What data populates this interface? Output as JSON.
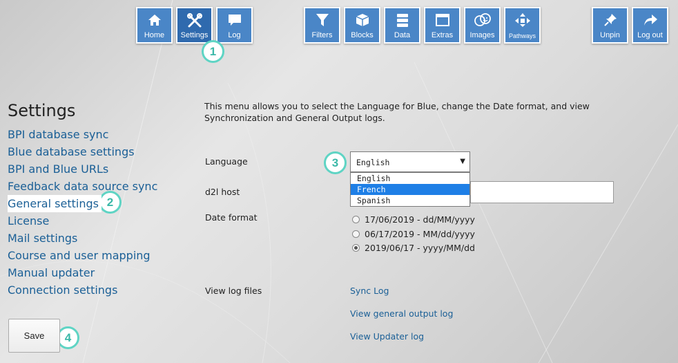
{
  "toolbar": {
    "home": "Home",
    "settings": "Settings",
    "log": "Log",
    "filters": "Filters",
    "blocks": "Blocks",
    "data": "Data",
    "extras": "Extras",
    "images": "Images",
    "pathways": "Pathways",
    "unpin": "Unpin",
    "logout": "Log out"
  },
  "badges": [
    "1",
    "2",
    "3",
    "4"
  ],
  "page": {
    "title": "Settings",
    "intro": "This menu allows you to select the Language for Blue, change the Date format, and view Synchronization and General Output logs."
  },
  "sidebar": {
    "items": [
      "BPI database sync",
      "Blue database settings",
      "BPI and Blue URLs",
      "Feedback data source sync",
      "General settings",
      "License",
      "Mail settings",
      "Course and user mapping",
      "Manual updater",
      "Connection settings"
    ],
    "active_index": 4
  },
  "form": {
    "language_label": "Language",
    "language_value": "English",
    "language_options": [
      "English",
      "French",
      "Spanish"
    ],
    "highlighted_option": "French",
    "host_label": "d2l host",
    "host_value": "",
    "date_label": "Date format",
    "date_options": [
      "17/06/2019 - dd/MM/yyyy",
      "06/17/2019 - MM/dd/yyyy",
      "2019/06/17 - yyyy/MM/dd"
    ],
    "date_selected_index": 2,
    "logs_label": "View log files",
    "log_links": [
      "Sync Log",
      "View general output log",
      "View Updater log"
    ]
  },
  "save_label": "Save",
  "colors": {
    "toolbar": "#4a86c7",
    "link": "#1a5f96",
    "badge": "#5fd4c4",
    "dropdown_highlight": "#1e7fe6"
  }
}
